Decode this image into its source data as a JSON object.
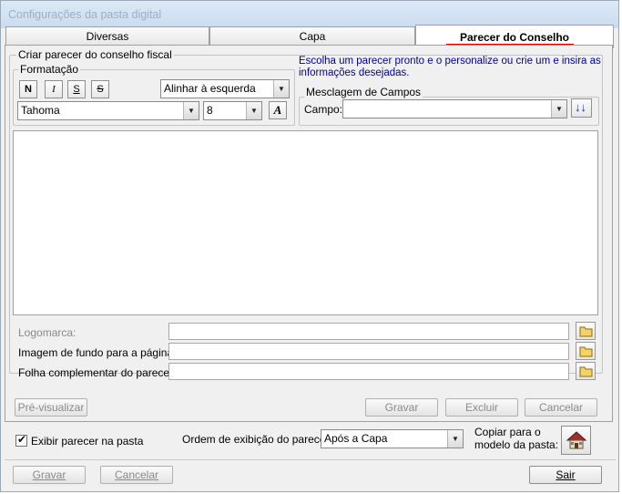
{
  "window": {
    "title": "Configurações da pasta digital"
  },
  "tabs": [
    {
      "label": "Diversas"
    },
    {
      "label": "Capa"
    },
    {
      "label": "Parecer do Conselho"
    }
  ],
  "create_group": {
    "legend": "Criar parecer do conselho fiscal"
  },
  "formatting": {
    "legend": "Formatação",
    "bold_label": "N",
    "italic_label": "I",
    "underline_label": "S",
    "strike_label": "S",
    "align_value": "Alinhar à esquerda",
    "font_value": "Tahoma",
    "size_value": "8",
    "color_label": "A"
  },
  "hint": "Escolha um parecer pronto e o personalize ou crie um e insira as informações desejadas.",
  "merge": {
    "legend": "Mesclagem de Campos",
    "field_label": "Campo:",
    "field_value": ""
  },
  "files": {
    "logo_label": "Logomarca:",
    "background_label": "Imagem de fundo para a página:",
    "supplement_label": "Folha complementar do parecer:"
  },
  "actions": {
    "preview": "Pré-visualizar",
    "save": "Gravar",
    "delete": "Excluir",
    "cancel": "Cancelar"
  },
  "options": {
    "show_label": "Exibir parecer na pasta",
    "show_checked": true,
    "order_label": "Ordem de exibição do parecer:",
    "order_value": "Após a Capa",
    "copy_label": "Copiar para o modelo da pasta:"
  },
  "footer": {
    "save": "Gravar",
    "cancel": "Cancelar",
    "exit": "Sair"
  },
  "colors": {
    "accent_underline": "#e00000",
    "hint_text": "#0000a0"
  }
}
